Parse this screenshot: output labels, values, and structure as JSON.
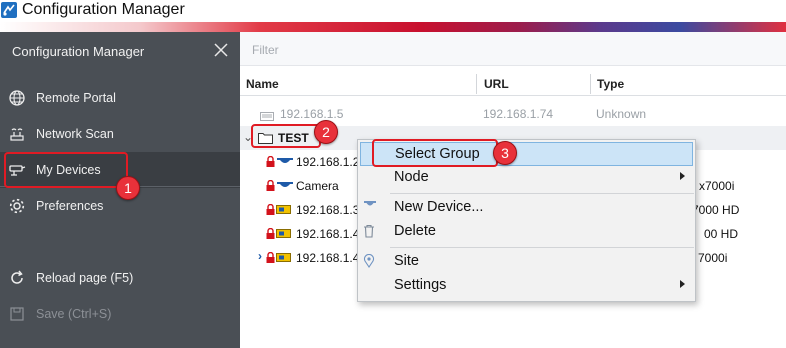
{
  "window": {
    "title": "Configuration Manager"
  },
  "sidebar": {
    "header": "Configuration Manager",
    "items": [
      {
        "label": "Remote Portal",
        "icon": "globe-icon"
      },
      {
        "label": "Network Scan",
        "icon": "network-icon"
      },
      {
        "label": "My Devices",
        "icon": "camera-icon",
        "active": true
      },
      {
        "label": "Preferences",
        "icon": "gear-icon"
      },
      {
        "label": "Reload page (F5)",
        "icon": "reload-icon"
      },
      {
        "label": "Save (Ctrl+S)",
        "icon": "save-icon",
        "disabled": true
      }
    ]
  },
  "main": {
    "filter_placeholder": "Filter",
    "columns": {
      "name": "Name",
      "url": "URL",
      "type": "Type"
    },
    "rows": [
      {
        "name": "192.168.1.5",
        "url": "192.168.1.74",
        "type": "Unknown"
      },
      {
        "name": "TEST"
      },
      {
        "name": "192.168.1.2",
        "type_partial": ""
      },
      {
        "name": "Camera",
        "type_partial": "x7000i"
      },
      {
        "name": "192.168.1.3",
        "type_partial": "7000 HD"
      },
      {
        "name": "192.168.1.4",
        "type_partial": "00 HD"
      },
      {
        "name": "192.168.1.4",
        "type_partial": "7000i"
      }
    ]
  },
  "context_menu": {
    "items": [
      {
        "label": "Select Group"
      },
      {
        "label": "Node",
        "submenu": true
      },
      {
        "label": "New Device...",
        "icon": "camera-icon"
      },
      {
        "label": "Delete",
        "icon": "trash-icon"
      },
      {
        "label": "Site",
        "icon": "location-icon"
      },
      {
        "label": "Settings",
        "submenu": true
      }
    ]
  },
  "annotations": {
    "badges": [
      "1",
      "2",
      "3"
    ]
  },
  "colors": {
    "sidebar": "#4a4f55",
    "accent_red": "#e01b24",
    "highlight": "#cce4f7"
  }
}
